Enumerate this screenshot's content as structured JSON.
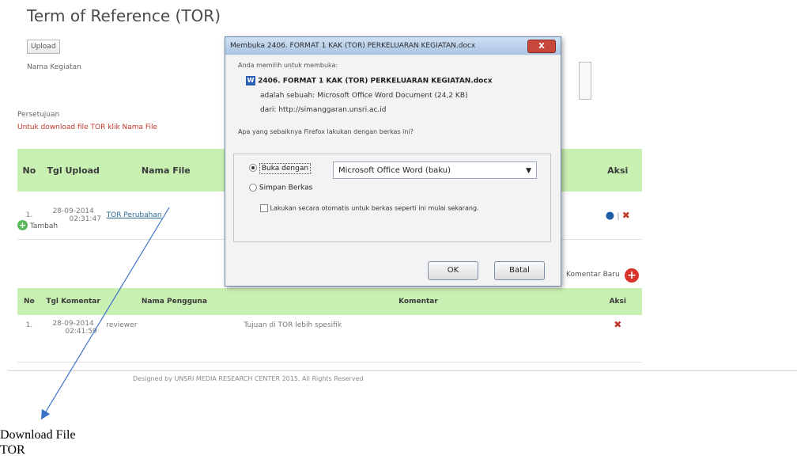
{
  "page": {
    "title": "Term of Reference (TOR)",
    "upload_button": "Upload",
    "nama_kegiatan_label": "Nama Kegiatan",
    "persetujuan_label": "Persetujuan",
    "download_hint": "Untuk download file TOR klik Nama File"
  },
  "files_table": {
    "headers": [
      "No",
      "Tgl Upload",
      "Nama File",
      "Aksi"
    ],
    "rows": [
      {
        "no": "1.",
        "date": "28-09-2014",
        "time": "02:31:47",
        "name": "TOR Perubahan"
      }
    ],
    "add_label": "Tambah"
  },
  "comments": {
    "new_comment_label": "Komentar Baru",
    "headers": [
      "No",
      "Tgl Komentar",
      "Nama Pengguna",
      "Komentar",
      "Aksi"
    ],
    "rows": [
      {
        "no": "1.",
        "date": "28-09-2014",
        "time": "02:41:59",
        "user": "reviewer",
        "comment": "Tujuan di TOR lebih spesifik"
      }
    ]
  },
  "footer": "Designed by UNSRI MEDIA RESEARCH CENTER 2015. All Rights Reserved",
  "dialog": {
    "title": "Membuka 2406. FORMAT 1 KAK (TOR) PERKELUARAN KEGIATAN.docx",
    "intro": "Anda memilih untuk membuka:",
    "filename": "2406. FORMAT 1 KAK (TOR) PERKELUARAN KEGIATAN.docx",
    "type_line": "adalah sebuah: Microsoft Office Word Document (24,2 KB)",
    "from_line": "dari: http://simanggaran.unsri.ac.id",
    "question": "Apa yang sebaiknya Firefox lakukan dengan berkas ini?",
    "open_with_label": "Buka dengan",
    "open_with_app": "Microsoft Office Word (baku)",
    "save_label": "Simpan Berkas",
    "auto_label": "Lakukan secara otomatis untuk berkas seperti ini mulai sekarang.",
    "ok": "OK",
    "cancel": "Batal",
    "close": "X"
  },
  "annotation": {
    "line1": "Download File",
    "line2": "TOR"
  },
  "colors": {
    "table_header": "#c9f0b3",
    "link": "#2a6a95",
    "annotation_arrow": "#3a72c8"
  }
}
